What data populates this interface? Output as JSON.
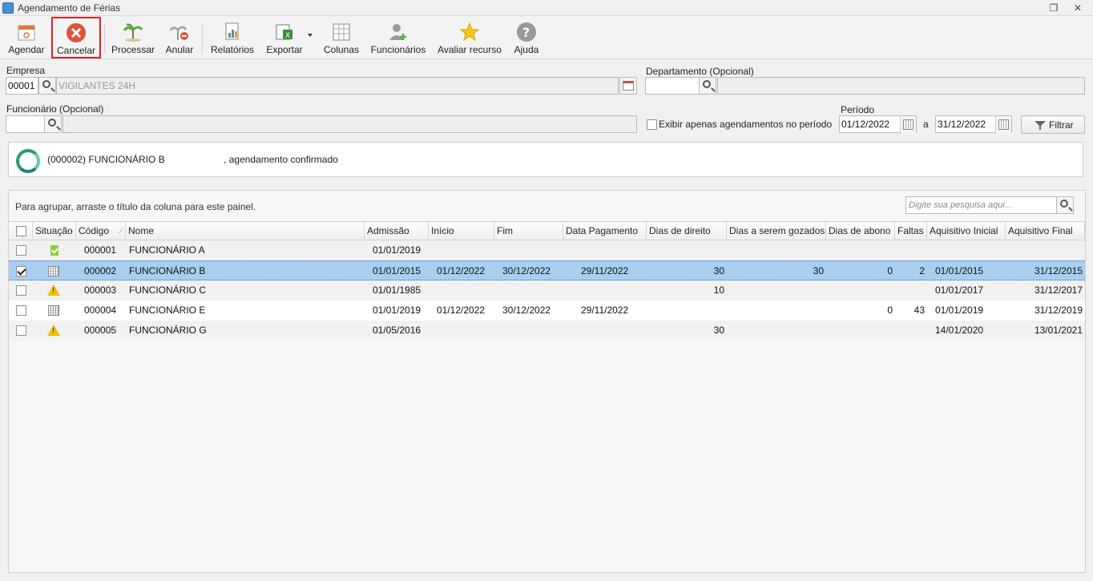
{
  "window": {
    "title": "Agendamento de Férias"
  },
  "toolbar": {
    "agendar": "Agendar",
    "cancelar": "Cancelar",
    "processar": "Processar",
    "anular": "Anular",
    "relatorios": "Relatórios",
    "exportar": "Exportar",
    "colunas": "Colunas",
    "funcionarios": "Funcionários",
    "avaliar": "Avaliar recurso",
    "ajuda": "Ajuda"
  },
  "form": {
    "empresa_label": "Empresa",
    "empresa_code": "00001",
    "empresa_name": "VIGILANTES 24H",
    "departamento_label": "Departamento (Opcional)",
    "funcionario_label": "Funcionário (Opcional)",
    "periodo_label": "Período",
    "exibir_label": "Exibir apenas agendamentos no período",
    "periodo_inicio": "01/12/2022",
    "periodo_sep": "a",
    "periodo_fim": "31/12/2022",
    "filtrar": "Filtrar"
  },
  "status": {
    "message": "(000002) FUNCIONÁRIO B                      , agendamento confirmado"
  },
  "grid": {
    "group_hint": "Para agrupar, arraste o título da coluna para este painel.",
    "search_placeholder": "Digite sua pesquisa aqui...",
    "columns": [
      "Situação",
      "Código",
      "Nome",
      "Admissão",
      "Início",
      "Fim",
      "Data Pagamento",
      "Dias de direito",
      "Dias a serem gozados",
      "Dias de abono",
      "Faltas",
      "Aquisitivo Inicial",
      "Aquisitivo Final"
    ],
    "rows": [
      {
        "situacao_icon": "document-check-icon",
        "codigo": "000001",
        "nome": "FUNCIONÁRIO A",
        "admissao": "01/01/2019",
        "inicio": "",
        "fim": "",
        "data_pagamento": "",
        "dias_direito": "",
        "dias_gozados": "",
        "dias_abono": "",
        "faltas": "",
        "aq_inicial": "",
        "aq_final": "",
        "checked": false
      },
      {
        "situacao_icon": "calendar-icon",
        "codigo": "000002",
        "nome": "FUNCIONÁRIO B",
        "admissao": "01/01/2015",
        "inicio": "01/12/2022",
        "fim": "30/12/2022",
        "data_pagamento": "29/11/2022",
        "dias_direito": "30",
        "dias_gozados": "30",
        "dias_abono": "0",
        "faltas": "2",
        "aq_inicial": "01/01/2015",
        "aq_final": "31/12/2015",
        "checked": true
      },
      {
        "situacao_icon": "warning-icon",
        "codigo": "000003",
        "nome": "FUNCIONÁRIO C",
        "admissao": "01/01/1985",
        "inicio": "",
        "fim": "",
        "data_pagamento": "",
        "dias_direito": "10",
        "dias_gozados": "",
        "dias_abono": "",
        "faltas": "",
        "aq_inicial": "01/01/2017",
        "aq_final": "31/12/2017",
        "checked": false
      },
      {
        "situacao_icon": "calendar-icon",
        "codigo": "000004",
        "nome": "FUNCIONÁRIO E",
        "admissao": "01/01/2019",
        "inicio": "01/12/2022",
        "fim": "30/12/2022",
        "data_pagamento": "29/11/2022",
        "dias_direito": "",
        "dias_gozados": "",
        "dias_abono": "0",
        "faltas": "43",
        "aq_inicial": "01/01/2019",
        "aq_final": "31/12/2019",
        "checked": false
      },
      {
        "situacao_icon": "warning-icon",
        "codigo": "000005",
        "nome": "FUNCIONÁRIO G",
        "admissao": "01/05/2016",
        "inicio": "",
        "fim": "",
        "data_pagamento": "",
        "dias_direito": "30",
        "dias_gozados": "",
        "dias_abono": "",
        "faltas": "",
        "aq_inicial": "14/01/2020",
        "aq_final": "13/01/2021",
        "checked": false
      }
    ]
  }
}
